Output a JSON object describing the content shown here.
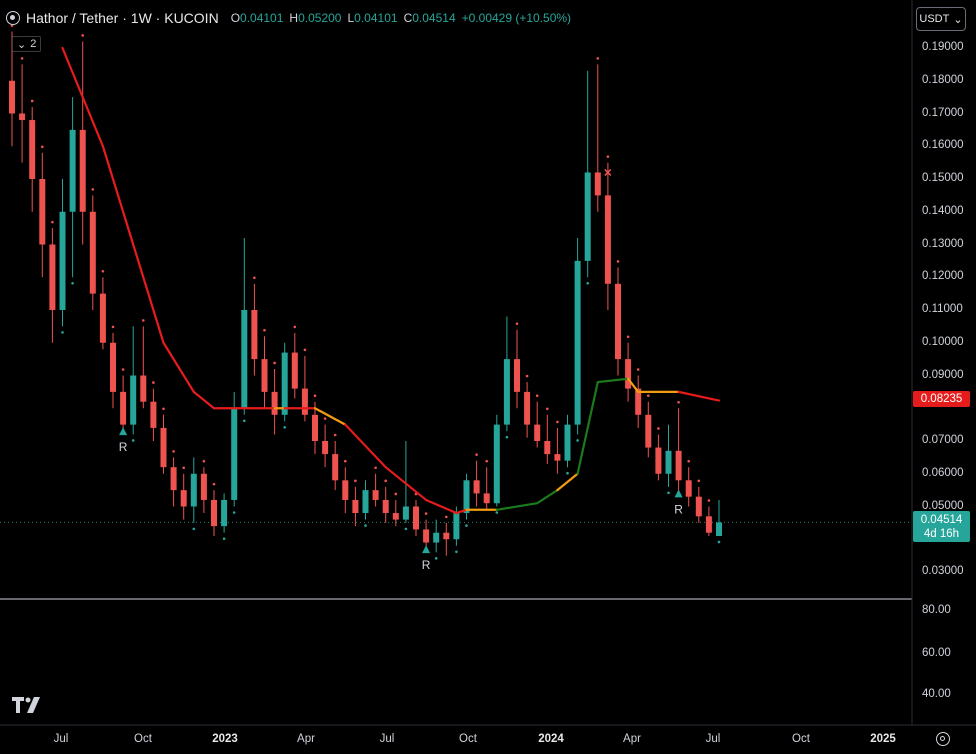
{
  "header": {
    "title": "Hathor / Tether · 1W · KUCOIN",
    "ohlc": [
      {
        "key": "O",
        "value": "0.04101"
      },
      {
        "key": "H",
        "value": "0.05200"
      },
      {
        "key": "L",
        "value": "0.04101"
      },
      {
        "key": "C",
        "value": "0.04514"
      },
      {
        "key": "",
        "value": "+0.00429 (+10.50%)"
      }
    ],
    "indicator_count": "2"
  },
  "currency_button": {
    "label": "USDT"
  },
  "price_axis": [
    "0.19000",
    "0.18000",
    "0.17000",
    "0.16000",
    "0.15000",
    "0.14000",
    "0.13000",
    "0.12000",
    "0.11000",
    "0.10000",
    "0.09000",
    "0.07000",
    "0.06000",
    "0.05000",
    "0.03000"
  ],
  "indicator_value_tag": "0.08235",
  "last_price_tag": {
    "price": "0.04514",
    "countdown": "4d 16h"
  },
  "oscillator_axis": [
    "80.00",
    "60.00",
    "40.00"
  ],
  "time_axis": [
    {
      "label": "Jul",
      "year": false
    },
    {
      "label": "Oct",
      "year": false
    },
    {
      "label": "2023",
      "year": true
    },
    {
      "label": "Apr",
      "year": false
    },
    {
      "label": "Jul",
      "year": false
    },
    {
      "label": "Oct",
      "year": false
    },
    {
      "label": "2024",
      "year": true
    },
    {
      "label": "Apr",
      "year": false
    },
    {
      "label": "Jul",
      "year": false
    },
    {
      "label": "Oct",
      "year": false
    },
    {
      "label": "2025",
      "year": true
    }
  ],
  "signals": [
    {
      "label": "R",
      "price": 0.073
    },
    {
      "label": "R",
      "price": 0.037
    },
    {
      "label": "R",
      "price": 0.054
    }
  ],
  "colors": {
    "up": "#26a69a",
    "down": "#ef5350",
    "line_red": "#e61c1c",
    "line_orange": "#f39c12",
    "line_green": "#1b7a1b",
    "background": "#000000"
  },
  "icons": {
    "symbol": "symbol-icon",
    "logo": "tradingview-logo-icon",
    "settings": "gear-icon",
    "chevron": "chevron-down-icon"
  },
  "chart_data": {
    "type": "candlestick",
    "pair": "HTR/USDT",
    "interval": "1W",
    "exchange": "KUCOIN",
    "y_range": [
      0.022,
      0.198
    ],
    "candles": [
      {
        "o": 0.18,
        "h": 0.195,
        "l": 0.16,
        "c": 0.17
      },
      {
        "o": 0.17,
        "h": 0.185,
        "l": 0.155,
        "c": 0.168
      },
      {
        "o": 0.168,
        "h": 0.172,
        "l": 0.14,
        "c": 0.15
      },
      {
        "o": 0.15,
        "h": 0.158,
        "l": 0.12,
        "c": 0.13
      },
      {
        "o": 0.13,
        "h": 0.135,
        "l": 0.1,
        "c": 0.11
      },
      {
        "o": 0.11,
        "h": 0.15,
        "l": 0.105,
        "c": 0.14
      },
      {
        "o": 0.14,
        "h": 0.175,
        "l": 0.12,
        "c": 0.165
      },
      {
        "o": 0.165,
        "h": 0.192,
        "l": 0.13,
        "c": 0.14
      },
      {
        "o": 0.14,
        "h": 0.145,
        "l": 0.11,
        "c": 0.115
      },
      {
        "o": 0.115,
        "h": 0.12,
        "l": 0.098,
        "c": 0.1
      },
      {
        "o": 0.1,
        "h": 0.103,
        "l": 0.08,
        "c": 0.085
      },
      {
        "o": 0.085,
        "h": 0.09,
        "l": 0.072,
        "c": 0.075
      },
      {
        "o": 0.075,
        "h": 0.105,
        "l": 0.072,
        "c": 0.09
      },
      {
        "o": 0.09,
        "h": 0.105,
        "l": 0.08,
        "c": 0.082
      },
      {
        "o": 0.082,
        "h": 0.086,
        "l": 0.07,
        "c": 0.074
      },
      {
        "o": 0.074,
        "h": 0.078,
        "l": 0.06,
        "c": 0.062
      },
      {
        "o": 0.062,
        "h": 0.065,
        "l": 0.05,
        "c": 0.055
      },
      {
        "o": 0.055,
        "h": 0.06,
        "l": 0.046,
        "c": 0.05
      },
      {
        "o": 0.05,
        "h": 0.065,
        "l": 0.045,
        "c": 0.06
      },
      {
        "o": 0.06,
        "h": 0.062,
        "l": 0.048,
        "c": 0.052
      },
      {
        "o": 0.052,
        "h": 0.055,
        "l": 0.041,
        "c": 0.044
      },
      {
        "o": 0.044,
        "h": 0.054,
        "l": 0.042,
        "c": 0.052
      },
      {
        "o": 0.052,
        "h": 0.085,
        "l": 0.05,
        "c": 0.08
      },
      {
        "o": 0.08,
        "h": 0.132,
        "l": 0.078,
        "c": 0.11
      },
      {
        "o": 0.11,
        "h": 0.118,
        "l": 0.09,
        "c": 0.095
      },
      {
        "o": 0.095,
        "h": 0.102,
        "l": 0.08,
        "c": 0.085
      },
      {
        "o": 0.085,
        "h": 0.092,
        "l": 0.072,
        "c": 0.078
      },
      {
        "o": 0.078,
        "h": 0.1,
        "l": 0.076,
        "c": 0.097
      },
      {
        "o": 0.097,
        "h": 0.103,
        "l": 0.083,
        "c": 0.086
      },
      {
        "o": 0.086,
        "h": 0.096,
        "l": 0.076,
        "c": 0.078
      },
      {
        "o": 0.078,
        "h": 0.082,
        "l": 0.066,
        "c": 0.07
      },
      {
        "o": 0.07,
        "h": 0.075,
        "l": 0.062,
        "c": 0.066
      },
      {
        "o": 0.066,
        "h": 0.07,
        "l": 0.055,
        "c": 0.058
      },
      {
        "o": 0.058,
        "h": 0.062,
        "l": 0.048,
        "c": 0.052
      },
      {
        "o": 0.052,
        "h": 0.056,
        "l": 0.044,
        "c": 0.048
      },
      {
        "o": 0.048,
        "h": 0.058,
        "l": 0.046,
        "c": 0.055
      },
      {
        "o": 0.055,
        "h": 0.06,
        "l": 0.05,
        "c": 0.052
      },
      {
        "o": 0.052,
        "h": 0.056,
        "l": 0.045,
        "c": 0.048
      },
      {
        "o": 0.048,
        "h": 0.052,
        "l": 0.044,
        "c": 0.046
      },
      {
        "o": 0.046,
        "h": 0.07,
        "l": 0.045,
        "c": 0.05
      },
      {
        "o": 0.05,
        "h": 0.052,
        "l": 0.041,
        "c": 0.043
      },
      {
        "o": 0.043,
        "h": 0.046,
        "l": 0.037,
        "c": 0.039
      },
      {
        "o": 0.039,
        "h": 0.046,
        "l": 0.036,
        "c": 0.042
      },
      {
        "o": 0.042,
        "h": 0.045,
        "l": 0.035,
        "c": 0.04
      },
      {
        "o": 0.04,
        "h": 0.05,
        "l": 0.038,
        "c": 0.048
      },
      {
        "o": 0.048,
        "h": 0.06,
        "l": 0.046,
        "c": 0.058
      },
      {
        "o": 0.058,
        "h": 0.064,
        "l": 0.05,
        "c": 0.054
      },
      {
        "o": 0.054,
        "h": 0.062,
        "l": 0.049,
        "c": 0.051
      },
      {
        "o": 0.051,
        "h": 0.078,
        "l": 0.05,
        "c": 0.075
      },
      {
        "o": 0.075,
        "h": 0.108,
        "l": 0.073,
        "c": 0.095
      },
      {
        "o": 0.095,
        "h": 0.104,
        "l": 0.08,
        "c": 0.085
      },
      {
        "o": 0.085,
        "h": 0.088,
        "l": 0.071,
        "c": 0.075
      },
      {
        "o": 0.075,
        "h": 0.082,
        "l": 0.068,
        "c": 0.07
      },
      {
        "o": 0.07,
        "h": 0.078,
        "l": 0.063,
        "c": 0.066
      },
      {
        "o": 0.066,
        "h": 0.074,
        "l": 0.06,
        "c": 0.064
      },
      {
        "o": 0.064,
        "h": 0.078,
        "l": 0.062,
        "c": 0.075
      },
      {
        "o": 0.075,
        "h": 0.132,
        "l": 0.072,
        "c": 0.125
      },
      {
        "o": 0.125,
        "h": 0.183,
        "l": 0.12,
        "c": 0.152
      },
      {
        "o": 0.152,
        "h": 0.185,
        "l": 0.14,
        "c": 0.145
      },
      {
        "o": 0.145,
        "h": 0.155,
        "l": 0.11,
        "c": 0.118
      },
      {
        "o": 0.118,
        "h": 0.123,
        "l": 0.09,
        "c": 0.095
      },
      {
        "o": 0.095,
        "h": 0.1,
        "l": 0.082,
        "c": 0.086
      },
      {
        "o": 0.086,
        "h": 0.09,
        "l": 0.074,
        "c": 0.078
      },
      {
        "o": 0.078,
        "h": 0.082,
        "l": 0.065,
        "c": 0.068
      },
      {
        "o": 0.068,
        "h": 0.072,
        "l": 0.058,
        "c": 0.06
      },
      {
        "o": 0.06,
        "h": 0.075,
        "l": 0.056,
        "c": 0.067
      },
      {
        "o": 0.067,
        "h": 0.08,
        "l": 0.055,
        "c": 0.058
      },
      {
        "o": 0.058,
        "h": 0.062,
        "l": 0.05,
        "c": 0.053
      },
      {
        "o": 0.053,
        "h": 0.056,
        "l": 0.045,
        "c": 0.047
      },
      {
        "o": 0.047,
        "h": 0.05,
        "l": 0.041,
        "c": 0.042
      },
      {
        "o": 0.041,
        "h": 0.052,
        "l": 0.041,
        "c": 0.04514
      }
    ],
    "indicator_line": [
      {
        "i": 5,
        "v": 0.19,
        "state": "red"
      },
      {
        "i": 9,
        "v": 0.16,
        "state": "red"
      },
      {
        "i": 12,
        "v": 0.13,
        "state": "red"
      },
      {
        "i": 15,
        "v": 0.1,
        "state": "red"
      },
      {
        "i": 18,
        "v": 0.085,
        "state": "red"
      },
      {
        "i": 20,
        "v": 0.08,
        "state": "red"
      },
      {
        "i": 26,
        "v": 0.08,
        "state": "orange"
      },
      {
        "i": 27,
        "v": 0.08,
        "state": "red"
      },
      {
        "i": 30,
        "v": 0.08,
        "state": "orange"
      },
      {
        "i": 33,
        "v": 0.075,
        "state": "red"
      },
      {
        "i": 37,
        "v": 0.062,
        "state": "red"
      },
      {
        "i": 41,
        "v": 0.052,
        "state": "red"
      },
      {
        "i": 44,
        "v": 0.048,
        "state": "red"
      },
      {
        "i": 45,
        "v": 0.049,
        "state": "orange"
      },
      {
        "i": 48,
        "v": 0.049,
        "state": "green"
      },
      {
        "i": 52,
        "v": 0.051,
        "state": "green"
      },
      {
        "i": 54,
        "v": 0.055,
        "state": "orange"
      },
      {
        "i": 56,
        "v": 0.06,
        "state": "green"
      },
      {
        "i": 58,
        "v": 0.088,
        "state": "green"
      },
      {
        "i": 61,
        "v": 0.089,
        "state": "orange"
      },
      {
        "i": 62,
        "v": 0.085,
        "state": "orange"
      },
      {
        "i": 66,
        "v": 0.085,
        "state": "red"
      },
      {
        "i": 70,
        "v": 0.08235,
        "state": "red"
      }
    ],
    "signal_markers": [
      {
        "i": 11,
        "label": "R"
      },
      {
        "i": 41,
        "label": "R"
      },
      {
        "i": 66,
        "label": "R"
      }
    ],
    "exit_marker": {
      "i": 58,
      "price": 0.152
    }
  }
}
